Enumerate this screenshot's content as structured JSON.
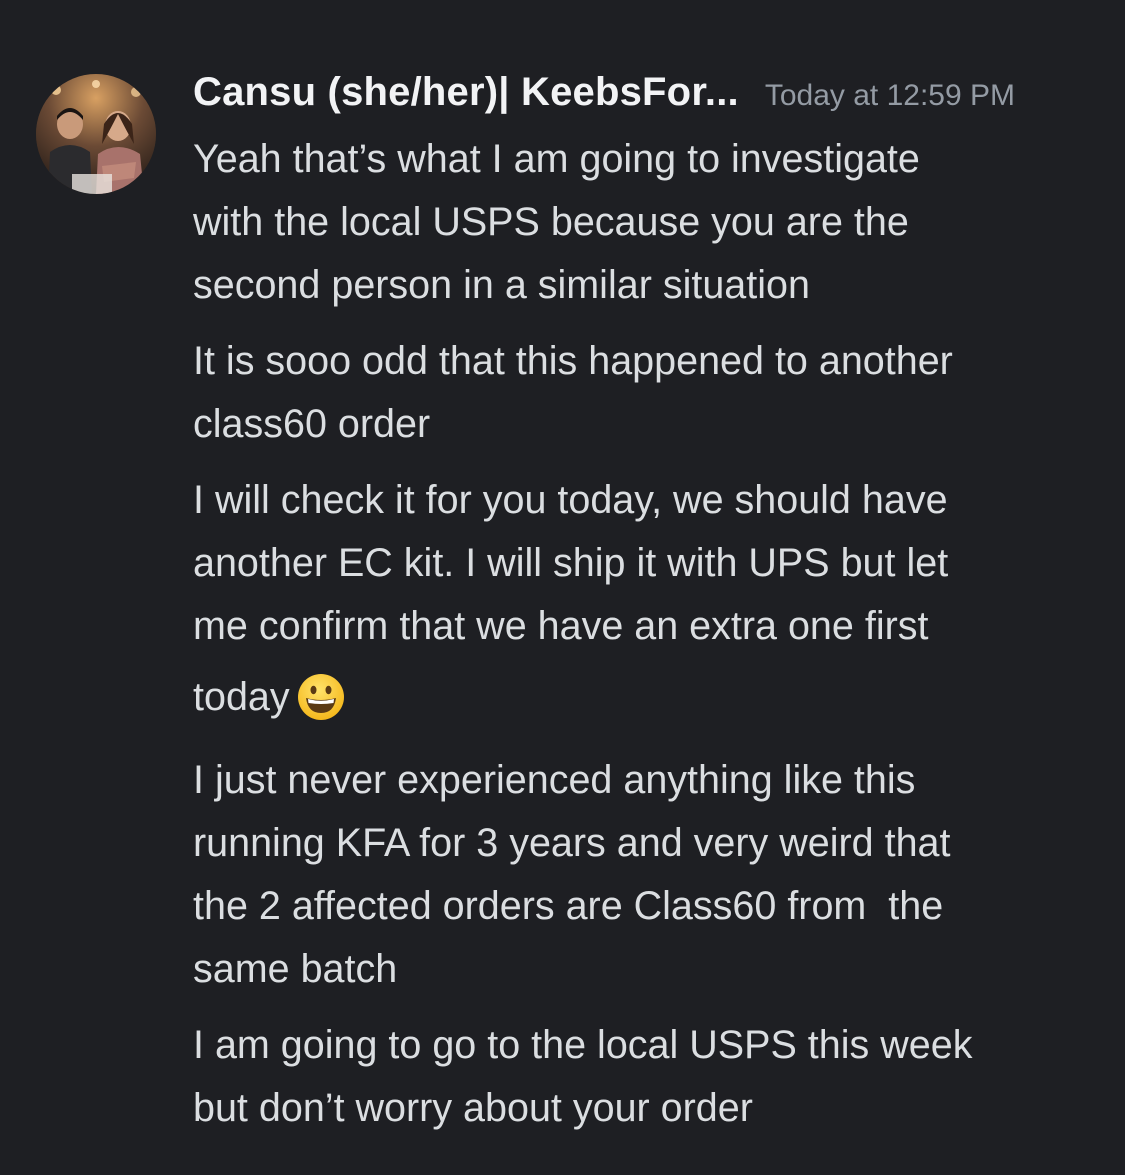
{
  "message": {
    "author": "Cansu (she/her)| KeebsFor...",
    "timestamp": "Today at 12:59 PM",
    "avatar_icon": "user-avatar-photo",
    "paragraphs": [
      [
        "Yeah that’s what I am going to investigate",
        "with the local USPS because you are the",
        "second person in a similar situation"
      ],
      [
        "It is sooo odd that this happened to another",
        "class60 order"
      ],
      [
        "I will check it for you today, we should have",
        "another EC kit. I will ship it with UPS but let",
        "me confirm that we have an extra one first",
        "today"
      ],
      [
        "I just never experienced anything like this",
        "running KFA for 3 years and very weird that",
        "the 2 affected orders are Class60 from  the",
        "same batch"
      ],
      [
        "I am going to go to the local USPS this week",
        "but don’t worry about your order"
      ]
    ],
    "emoji": "grinning-face-emoji",
    "colors": {
      "background": "#1e1f23",
      "author": "#f2f3f5",
      "text": "#dbdee1",
      "timestamp": "#949ba4"
    }
  }
}
